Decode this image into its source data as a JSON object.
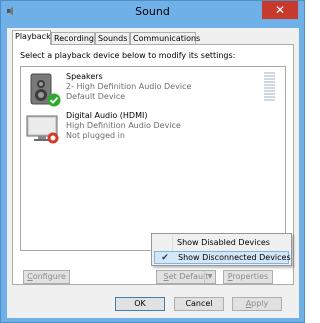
{
  "window": {
    "title": "Sound",
    "close_glyph": "✕"
  },
  "tabs": [
    {
      "label": "Playback",
      "active": true
    },
    {
      "label": "Recording",
      "active": false
    },
    {
      "label": "Sounds",
      "active": false
    },
    {
      "label": "Communications",
      "active": false
    }
  ],
  "playback": {
    "instruction": "Select a playback device below to modify its settings:",
    "devices": [
      {
        "name": "Speakers",
        "line2": "2- High Definition Audio Device",
        "line3": "Default Device",
        "icon": "speaker-icon",
        "status_icon": "green-check-icon"
      },
      {
        "name": "Digital Audio (HDMI)",
        "line2": "High Definition Audio Device",
        "line3": "Not plugged in",
        "icon": "hdmi-display-icon",
        "status_icon": "red-unplugged-icon"
      }
    ]
  },
  "context_menu": {
    "items": [
      {
        "label": "Show Disabled Devices",
        "checked": false,
        "highlighted": false
      },
      {
        "label": "Show Disconnected Devices",
        "checked": true,
        "highlighted": true
      }
    ]
  },
  "buttons": {
    "configure": {
      "prefix": "",
      "ul": "C",
      "rest": "onfigure",
      "enabled": false
    },
    "set_default": {
      "prefix": "",
      "ul": "S",
      "rest": "et Default",
      "enabled": false
    },
    "properties": {
      "prefix": "",
      "ul": "P",
      "rest": "roperties",
      "enabled": false
    },
    "ok": {
      "label": "OK"
    },
    "cancel": {
      "label": "Cancel"
    },
    "apply": {
      "prefix": "",
      "ul": "A",
      "rest": "pply",
      "enabled": false
    }
  },
  "colors": {
    "title_bar": "#6fb0e8",
    "close_button": "#c7392b",
    "menu_highlight": "#d5e6f7",
    "check_green": "#2fa82f",
    "unplugged_red": "#d23a2a"
  }
}
